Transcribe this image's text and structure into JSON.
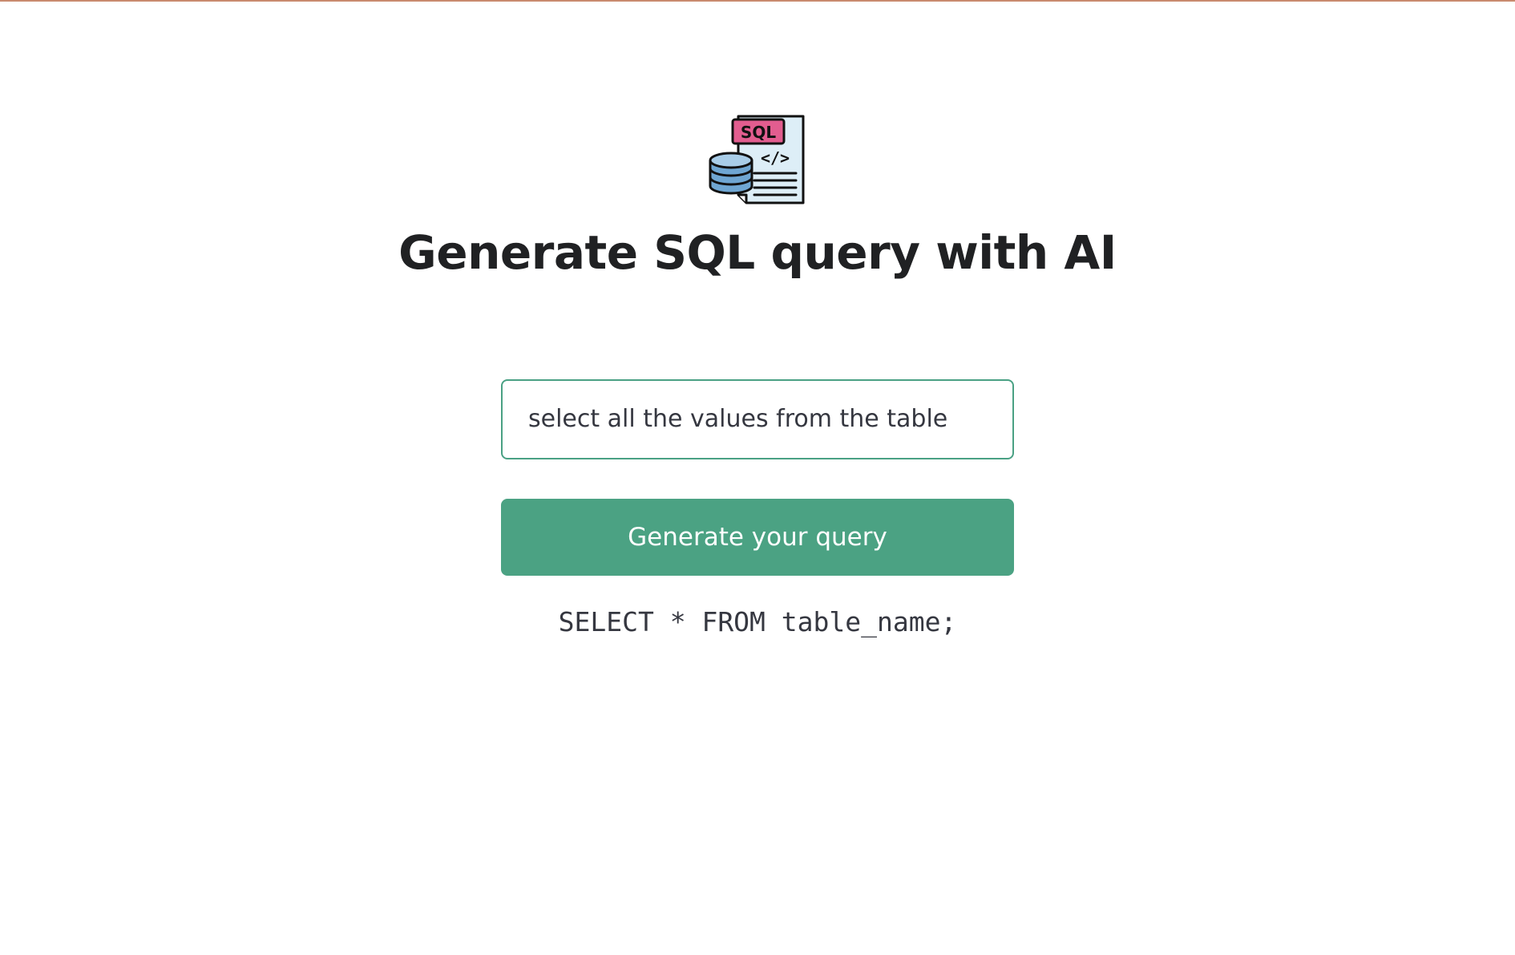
{
  "colors": {
    "accent": "#4ba283",
    "input_border": "#4aa184",
    "title_text": "#202123",
    "body_text": "#353740",
    "top_rule": "#c98a6e"
  },
  "logo": {
    "icon": "sql-database-document-icon",
    "badge_text": "SQL",
    "code_glyph": "</>"
  },
  "header": {
    "title": "Generate SQL query with AI"
  },
  "form": {
    "input_value": "select all the values from the table",
    "submit_label": "Generate your query"
  },
  "result": {
    "query": "SELECT * FROM table_name;"
  }
}
